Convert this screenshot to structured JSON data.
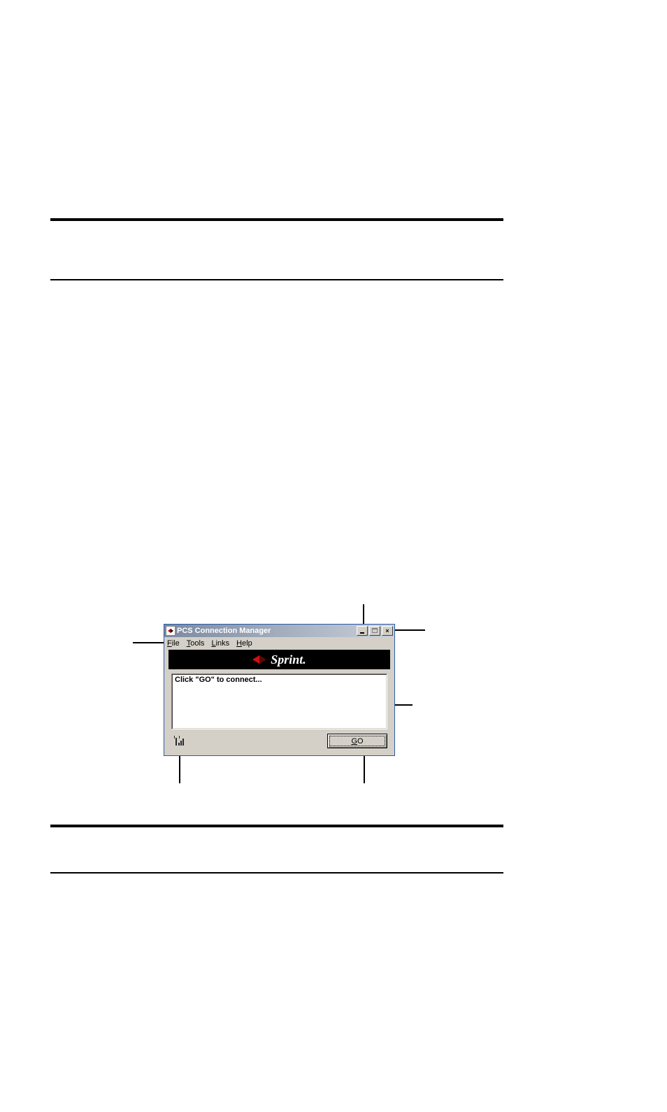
{
  "rules": {
    "positions": {
      "hr1": 312,
      "hr2": 399,
      "hr3": 1179,
      "hr4": 1247
    }
  },
  "window": {
    "title": "PCS Connection Manager",
    "menubar": {
      "file": "File",
      "file_key": "F",
      "tools": "Tools",
      "tools_key": "T",
      "links": "Links",
      "links_key": "L",
      "help": "Help",
      "help_key": "H"
    },
    "brand": "Sprint.",
    "main_text": "Click \"GO\" to connect...",
    "go_label": "GO",
    "go_key": "G",
    "buttons": {
      "minimize": "minimize",
      "maximize": "maximize",
      "close": "close"
    },
    "signal_name": "signal-strength-icon"
  }
}
